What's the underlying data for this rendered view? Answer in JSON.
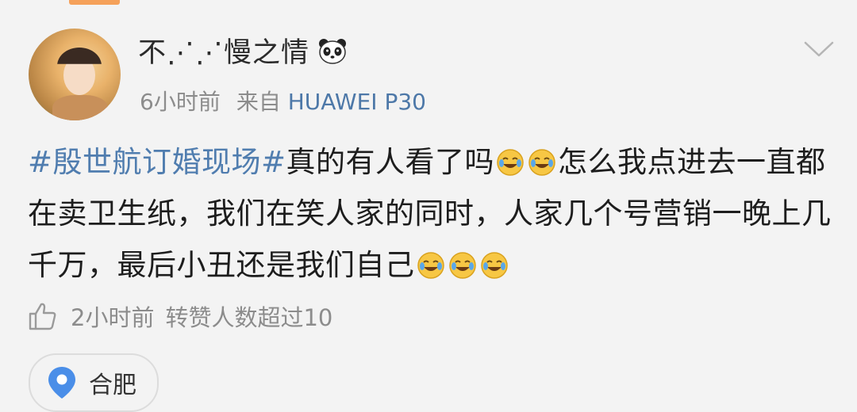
{
  "post": {
    "username": "不⋰⋰慢之情",
    "username_suffix_icon": "panda-icon",
    "time": "6小时前",
    "source_prefix": "来自",
    "device": "HUAWEI P30",
    "content": {
      "hashtag": "#殷世航订婚现场#",
      "text_1": "真的有人看了吗",
      "text_2": "怎么我点进去一直都在卖卫生纸，我们在笑人家的同时，人家几个号营销一晚上几千万，最后小丑还是我们自己",
      "emoji": "laugh-cry-emoji"
    },
    "footer": {
      "time": "2小时前",
      "stat": "转赞人数超过10"
    },
    "location": "合肥"
  },
  "colors": {
    "background": "#f3f3f3",
    "link": "#507daf",
    "meta": "#8c8c8c",
    "accent": "#f5a15a"
  }
}
